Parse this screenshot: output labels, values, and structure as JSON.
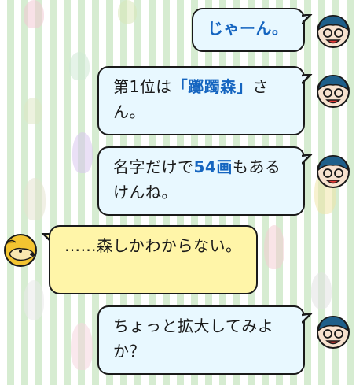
{
  "messages": [
    {
      "side": "right",
      "speaker": "boy",
      "parts": [
        {
          "text": "じゃーん。",
          "style": "blue"
        }
      ]
    },
    {
      "side": "right",
      "speaker": "boy",
      "parts": [
        {
          "text": "第1位は",
          "style": "normal"
        },
        {
          "text": "「躑躅森」",
          "style": "blue"
        },
        {
          "text": "さん。",
          "style": "normal"
        }
      ]
    },
    {
      "side": "right",
      "speaker": "boy",
      "parts": [
        {
          "text": "名字だけで",
          "style": "normal"
        },
        {
          "text": "54画",
          "style": "blue"
        },
        {
          "text": "もあるけんね。",
          "style": "normal"
        }
      ]
    },
    {
      "side": "left",
      "speaker": "dog",
      "parts": [
        {
          "text": "……森しかわからない。",
          "style": "normal"
        }
      ]
    },
    {
      "side": "right",
      "speaker": "boy",
      "parts": [
        {
          "text": "ちょっと拡大してみよか？",
          "style": "normal"
        }
      ]
    }
  ],
  "colors": {
    "accent": "#1565c0",
    "right_bubble": "#e8f8ff",
    "left_bubble": "#fff5a8",
    "stripe": "#d6ecd1"
  }
}
